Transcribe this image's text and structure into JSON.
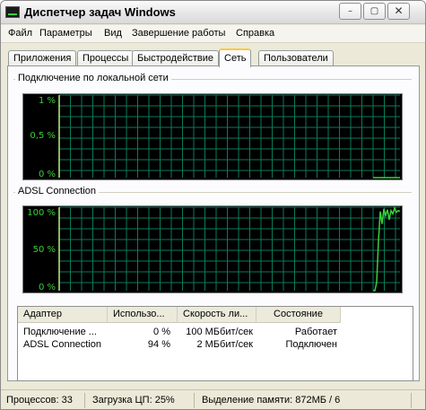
{
  "window": {
    "title": "Диспетчер задач Windows",
    "buttons": [
      "–",
      "▢",
      "✕"
    ]
  },
  "menu": {
    "items": [
      "Файл",
      "Параметры",
      "Вид",
      "Завершение работы",
      "Справка"
    ]
  },
  "tabs": {
    "items": [
      "Приложения",
      "Процессы",
      "Быстродействие",
      "Сеть",
      "Пользователи"
    ],
    "active": "Сеть"
  },
  "graphs": [
    {
      "title": "Подключение по локальной сети",
      "y_labels": [
        "1 %",
        "0,5 %",
        "0 %"
      ],
      "color": "#3ad03a",
      "grid_color": "#0a7a5a"
    },
    {
      "title": "ADSL Connection",
      "y_labels": [
        "100 %",
        "50 %",
        "0 %"
      ],
      "color": "#3ad03a",
      "grid_color": "#0a7a5a"
    }
  ],
  "chart_data": [
    {
      "type": "line",
      "title": "Подключение по локальной сети",
      "ylabel": "",
      "ylim": [
        0,
        1
      ],
      "tick_labels": [
        "1 %",
        "0,5 %",
        "0 %"
      ],
      "series": [
        {
          "values": [
            0,
            0,
            0,
            0,
            0,
            0,
            0,
            0,
            0,
            0
          ]
        }
      ],
      "grid": true
    },
    {
      "type": "line",
      "title": "ADSL Connection",
      "ylabel": "",
      "ylim": [
        0,
        100
      ],
      "tick_labels": [
        "100 %",
        "50 %",
        "0 %"
      ],
      "series": [
        {
          "values": [
            0,
            0,
            10,
            60,
            95,
            80,
            98,
            90,
            97,
            85,
            96,
            92,
            99,
            94,
            96,
            95
          ]
        }
      ],
      "grid": true
    }
  ],
  "table": {
    "headers": [
      "Адаптер",
      "Использо...",
      "Скорость ли...",
      "Состояние"
    ],
    "rows": [
      [
        "Подключение ...",
        "0 %",
        "100 МБбит/сек",
        "Работает"
      ],
      [
        "ADSL Connection",
        "94 %",
        "2 МБбит/сек",
        "Подключен"
      ]
    ]
  },
  "status": {
    "processes": "Процессов: 33",
    "cpu": "Загрузка ЦП: 25%",
    "memory": "Выделение памяти: 872МБ / 6"
  }
}
